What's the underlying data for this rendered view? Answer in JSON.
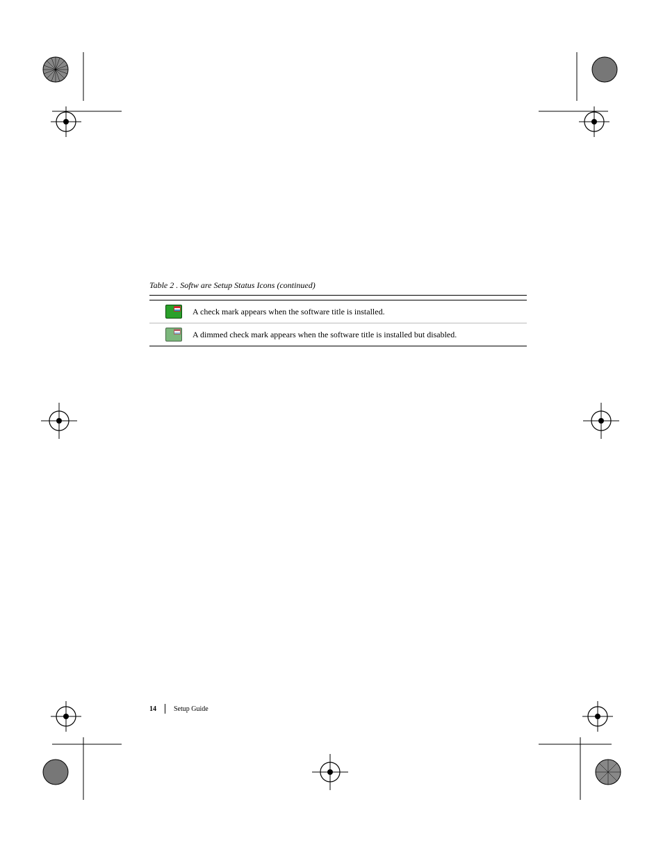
{
  "table": {
    "caption": "Table 2 . Softw are Setup Status Icons (continued)",
    "rows": [
      {
        "icon": "disk-check-icon",
        "text": "A check mark appears when the software title is installed."
      },
      {
        "icon": "disk-check-dim-icon",
        "text": "A dimmed check mark appears when the software title is installed but disabled."
      }
    ]
  },
  "footer": {
    "page_number": "14",
    "title": "Setup Guide"
  }
}
